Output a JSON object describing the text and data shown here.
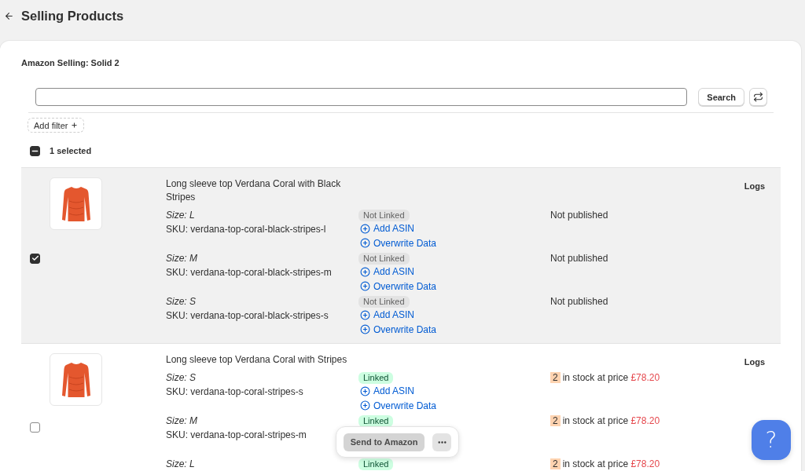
{
  "header": {
    "title": "Selling Products"
  },
  "card": {
    "title": "Amazon Selling: Solid 2"
  },
  "search": {
    "button": "Search"
  },
  "filters": {
    "add_filter": "Add filter"
  },
  "bulk_select": {
    "indeterminate": true,
    "label": "1 selected"
  },
  "products": [
    {
      "selected": true,
      "title": "Long sleeve top Verdana Coral with Black Stripes",
      "logs": "Logs",
      "variants": [
        {
          "size": "Size: L",
          "sku": "SKU: verdana-top-coral-black-stripes-l",
          "linked": false,
          "badge": "Not Linked",
          "actions": [
            "Add ASIN",
            "Overwrite Data"
          ],
          "listing": {
            "kind": "text",
            "text": "Not published"
          }
        },
        {
          "size": "Size: M",
          "sku": "SKU: verdana-top-coral-black-stripes-m",
          "linked": false,
          "badge": "Not Linked",
          "actions": [
            "Add ASIN",
            "Overwrite Data"
          ],
          "listing": {
            "kind": "text",
            "text": "Not published"
          }
        },
        {
          "size": "Size: S",
          "sku": "SKU: verdana-top-coral-black-stripes-s",
          "linked": false,
          "badge": "Not Linked",
          "actions": [
            "Add ASIN",
            "Overwrite Data"
          ],
          "listing": {
            "kind": "text",
            "text": "Not published"
          }
        }
      ]
    },
    {
      "selected": false,
      "title": "Long sleeve top Verdana Coral with Stripes",
      "logs": "Logs",
      "variants": [
        {
          "size": "Size: S",
          "sku": "SKU: verdana-top-coral-stripes-s",
          "linked": true,
          "badge": "Linked",
          "actions": [
            "Add ASIN",
            "Overwrite Data"
          ],
          "listing": {
            "kind": "stock",
            "quantity": "2",
            "text": "in stock at price",
            "price": "£78.20"
          }
        },
        {
          "size": "Size: M",
          "sku": "SKU: verdana-top-coral-stripes-m",
          "linked": true,
          "badge": "Linked",
          "listing": {
            "kind": "stock",
            "quantity": "2",
            "text": "in stock at price",
            "price": "£78.20"
          }
        },
        {
          "size": "Size: L",
          "linked": true,
          "badge": "Linked",
          "listing": {
            "kind": "stock",
            "quantity": "2",
            "text": "in stock at price",
            "price": "£78.20"
          }
        }
      ]
    }
  ],
  "action_bar": {
    "primary": "Send to Amazon"
  },
  "help_button": {
    "label": "?"
  }
}
